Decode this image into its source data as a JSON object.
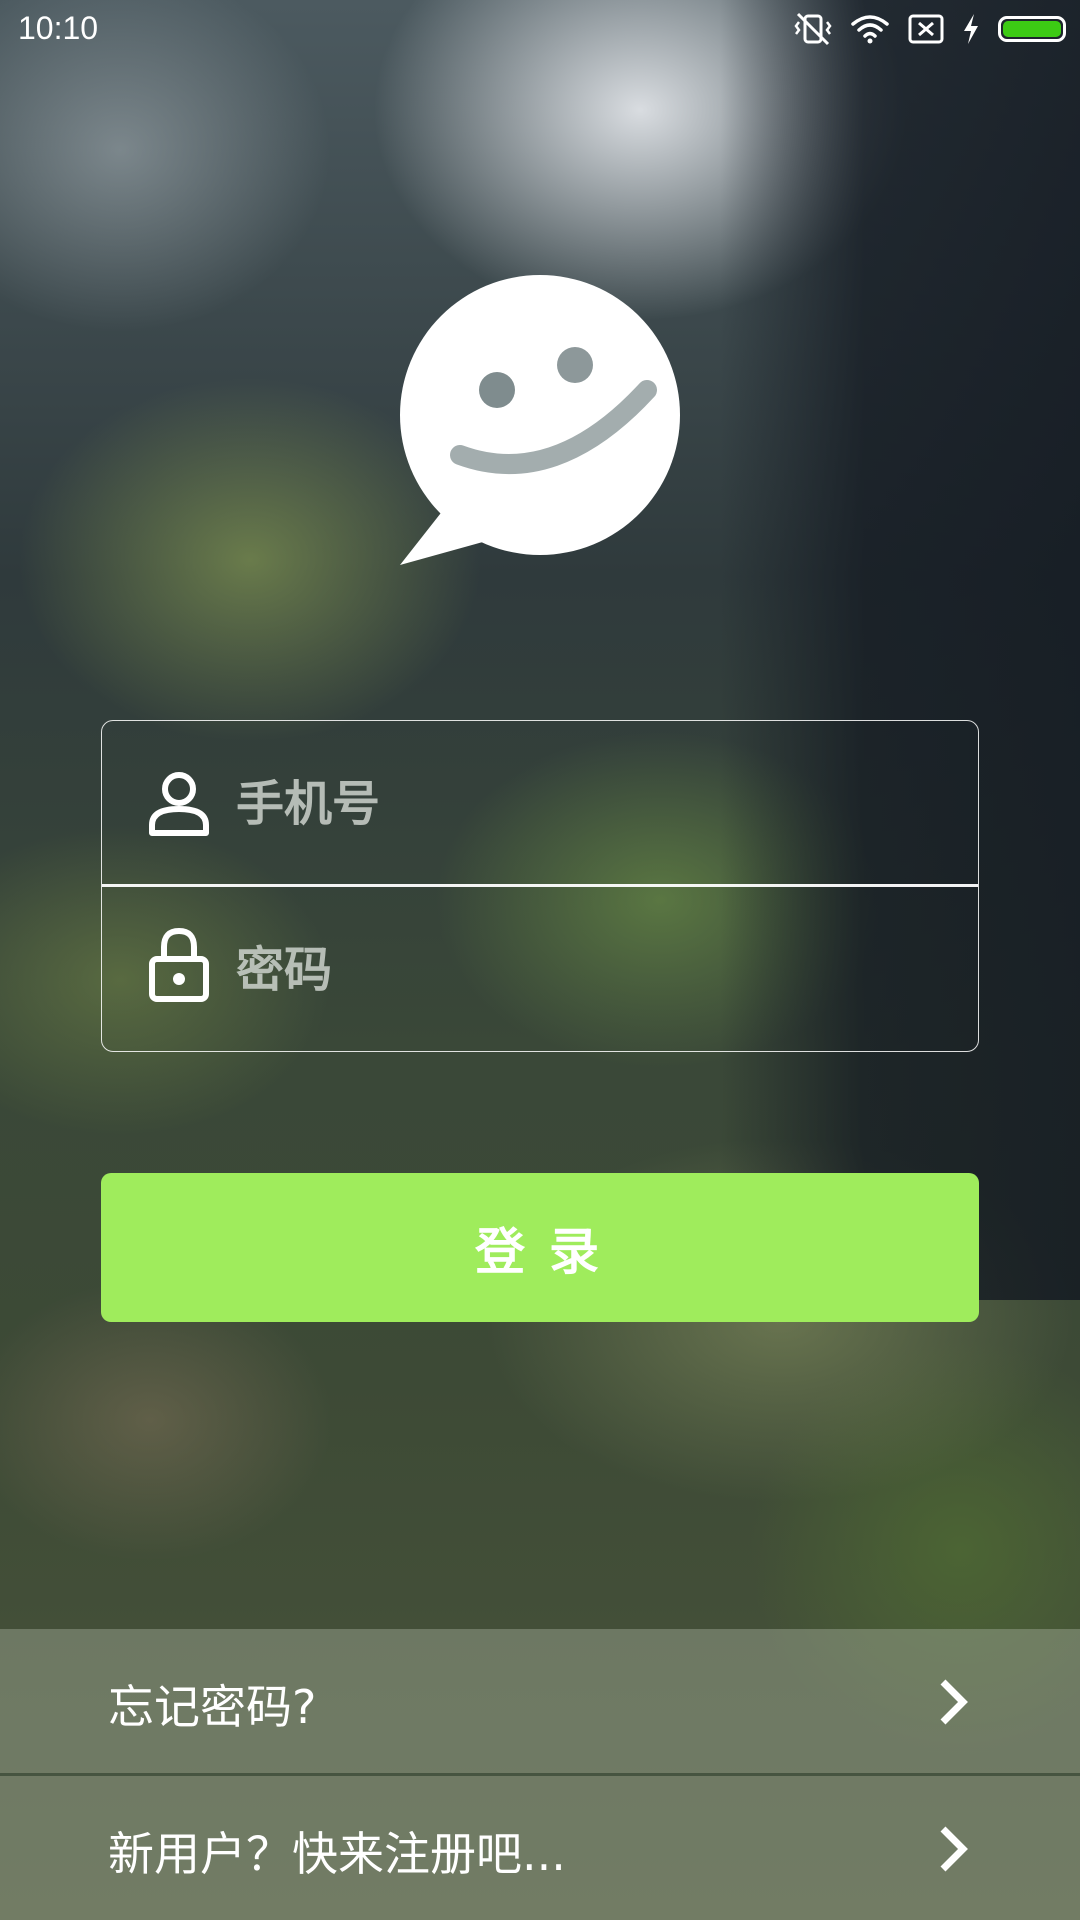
{
  "status_bar": {
    "time": "10:10",
    "icons": [
      "vibrate-off-icon",
      "wifi-icon",
      "no-sim-icon",
      "charging-bolt-icon",
      "battery-icon"
    ],
    "battery_level": 1.0,
    "battery_color": "#3ccb14"
  },
  "logo": {
    "icon": "smiley-chat-bubble-logo"
  },
  "login_form": {
    "phone": {
      "icon": "user-icon",
      "placeholder": "手机号",
      "value": ""
    },
    "password": {
      "icon": "lock-icon",
      "placeholder": "密码",
      "value": ""
    },
    "submit_label": "登录",
    "submit_color": "#9fec5c"
  },
  "links": {
    "forgot_password": "忘记密码?",
    "register": "新用户？快来注册吧..."
  }
}
